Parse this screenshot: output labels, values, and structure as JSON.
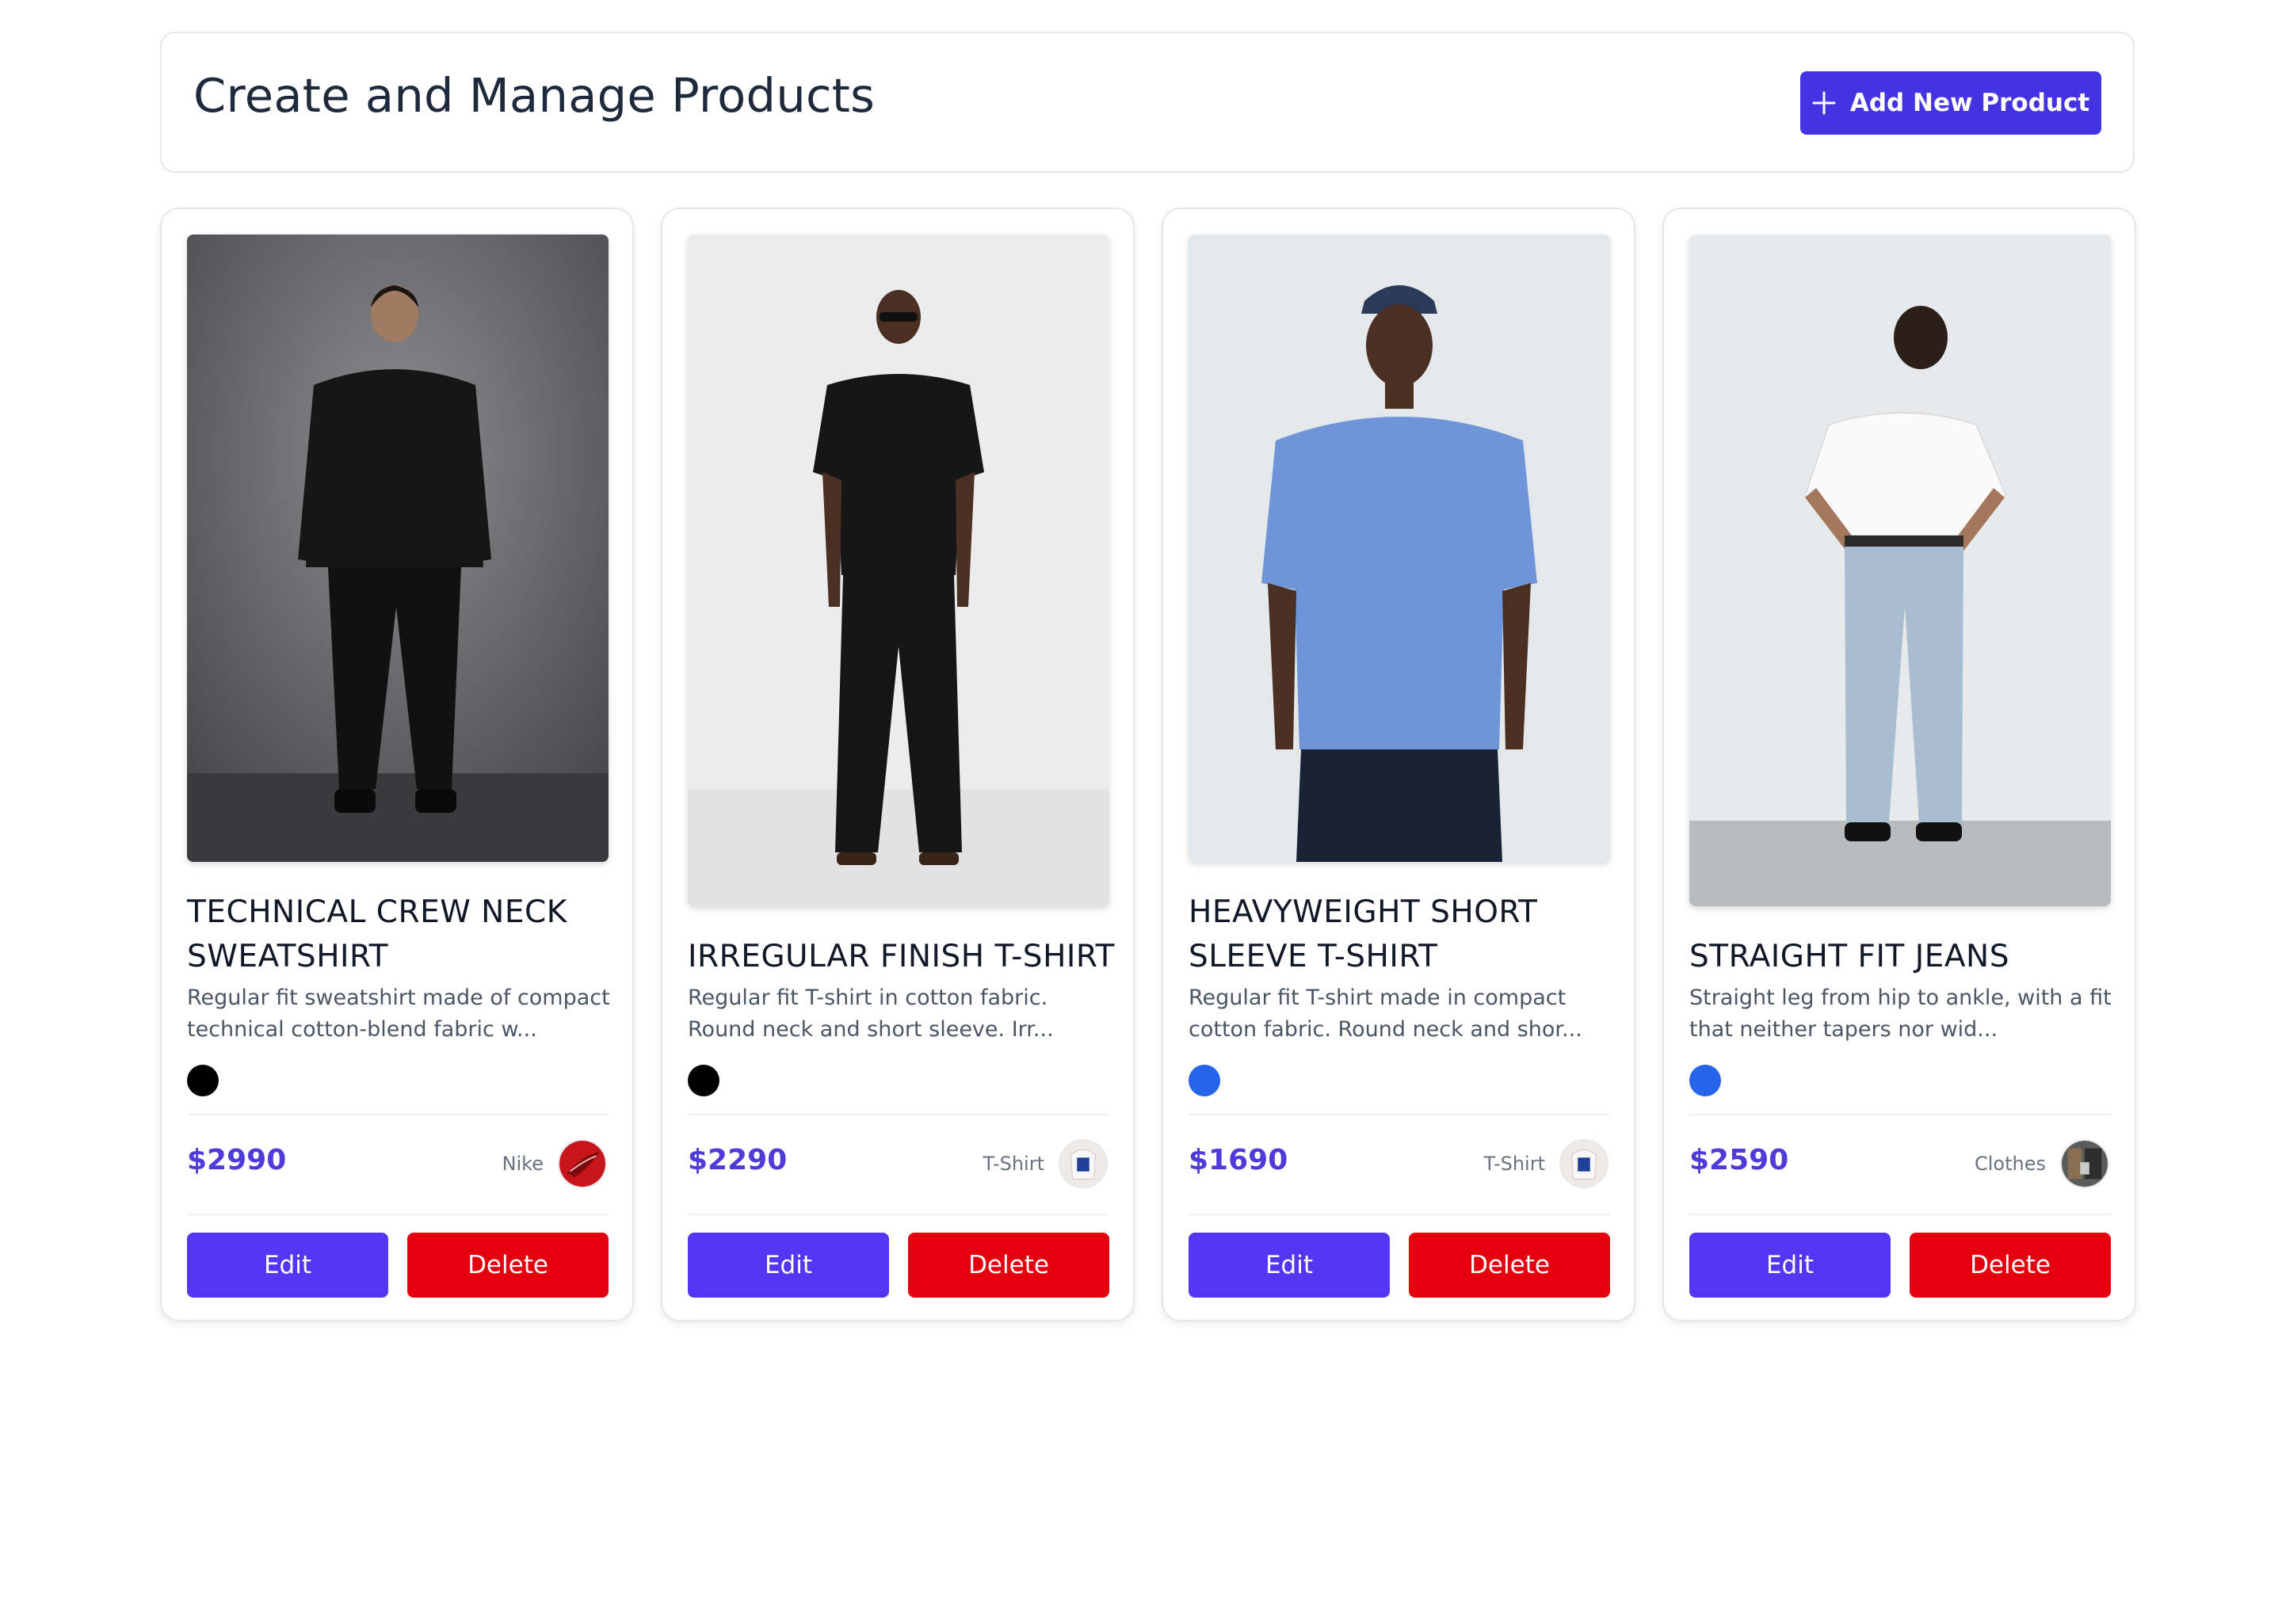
{
  "header": {
    "title": "Create and Manage Products",
    "add_button_label": "Add New Product"
  },
  "products": [
    {
      "name": "TECHNICAL CREW NECK SWEATSHIRT",
      "description": "Regular fit sweatshirt made of compact technical cotton-blend fabric w...",
      "color": "#000000",
      "price": "$2990",
      "category": "Nike",
      "edit_label": "Edit",
      "delete_label": "Delete"
    },
    {
      "name": "IRREGULAR FINISH T-SHIRT",
      "description": "Regular fit T-shirt in cotton fabric. Round neck and short sleeve. Irr...",
      "color": "#000000",
      "price": "$2290",
      "category": "T-Shirt",
      "edit_label": "Edit",
      "delete_label": "Delete"
    },
    {
      "name": "HEAVYWEIGHT SHORT SLEEVE T-SHIRT",
      "description": "Regular fit T-shirt made in compact cotton fabric. Round neck and shor...",
      "color": "#2563eb",
      "price": "$1690",
      "category": "T-Shirt",
      "edit_label": "Edit",
      "delete_label": "Delete"
    },
    {
      "name": "STRAIGHT FIT JEANS",
      "description": "Straight leg from hip to ankle, with a fit that neither tapers nor wid...",
      "color": "#2563eb",
      "price": "$2590",
      "category": "Clothes",
      "edit_label": "Edit",
      "delete_label": "Delete"
    }
  ],
  "colors": {
    "accent": "#4433e0",
    "price": "#4f3bd9",
    "edit": "#5436f2",
    "delete": "#e5000f"
  }
}
